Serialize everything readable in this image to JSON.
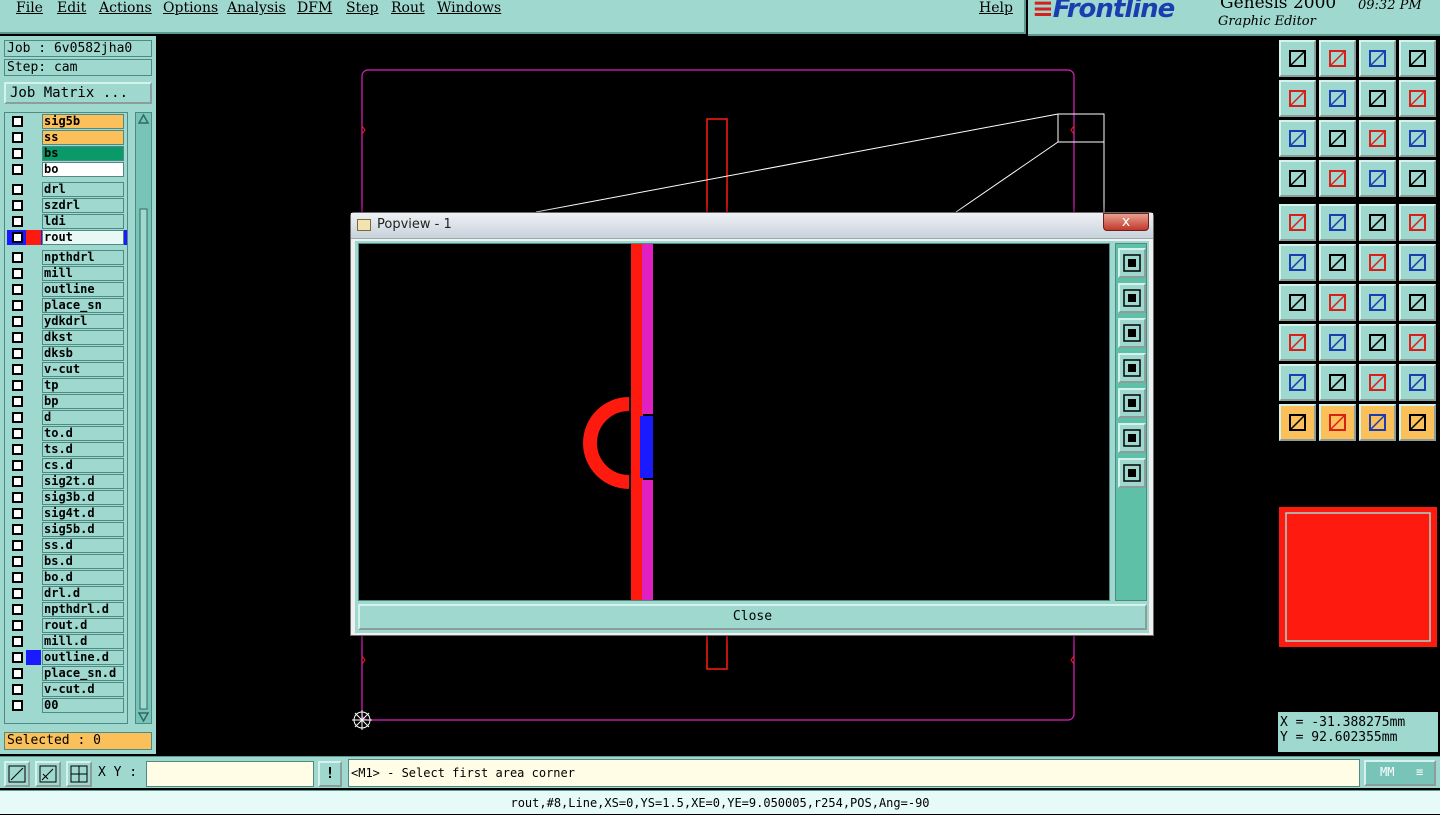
{
  "menu": {
    "items": [
      "File",
      "Edit",
      "Actions",
      "Options",
      "Analysis",
      "DFM",
      "Step",
      "Rout",
      "Windows"
    ],
    "help": "Help"
  },
  "brand": {
    "logo": "Frontline",
    "title": "Genesis 2000",
    "subtitle": "Graphic Editor",
    "clock": "09:32 PM"
  },
  "left": {
    "job": "Job : 6v0582jha0",
    "step": "Step: cam",
    "job_matrix": "Job Matrix ...",
    "selected": "Selected : 0",
    "layers": [
      {
        "name": "sig5b",
        "bg": "#fbc05a",
        "swatch": ""
      },
      {
        "name": "ss",
        "bg": "#fbc05a",
        "swatch": ""
      },
      {
        "name": "bs",
        "bg": "#0a9a6a",
        "swatch": ""
      },
      {
        "name": "bo",
        "bg": "#ffffff",
        "swatch": ""
      },
      {
        "name": "drl",
        "bg": "#9fd8cf",
        "swatch": "",
        "gap": true
      },
      {
        "name": "szdrl",
        "bg": "#9fd8cf",
        "swatch": ""
      },
      {
        "name": "ldi",
        "bg": "#9fd8cf",
        "swatch": ""
      },
      {
        "name": "rout",
        "bg": "#e8f8f5",
        "swatch": "#ff1a10",
        "active": true
      },
      {
        "name": "npthdrl",
        "bg": "#9fd8cf",
        "swatch": "",
        "gap": true
      },
      {
        "name": "mill",
        "bg": "#9fd8cf",
        "swatch": ""
      },
      {
        "name": "outline",
        "bg": "#9fd8cf",
        "swatch": ""
      },
      {
        "name": "place_sn",
        "bg": "#9fd8cf",
        "swatch": ""
      },
      {
        "name": "ydkdrl",
        "bg": "#9fd8cf",
        "swatch": ""
      },
      {
        "name": "dkst",
        "bg": "#9fd8cf",
        "swatch": ""
      },
      {
        "name": "dksb",
        "bg": "#9fd8cf",
        "swatch": ""
      },
      {
        "name": "v-cut",
        "bg": "#9fd8cf",
        "swatch": ""
      },
      {
        "name": "tp",
        "bg": "#9fd8cf",
        "swatch": ""
      },
      {
        "name": "bp",
        "bg": "#9fd8cf",
        "swatch": ""
      },
      {
        "name": "d",
        "bg": "#9fd8cf",
        "swatch": ""
      },
      {
        "name": "to.d",
        "bg": "#9fd8cf",
        "swatch": ""
      },
      {
        "name": "ts.d",
        "bg": "#9fd8cf",
        "swatch": ""
      },
      {
        "name": "cs.d",
        "bg": "#9fd8cf",
        "swatch": ""
      },
      {
        "name": "sig2t.d",
        "bg": "#9fd8cf",
        "swatch": ""
      },
      {
        "name": "sig3b.d",
        "bg": "#9fd8cf",
        "swatch": ""
      },
      {
        "name": "sig4t.d",
        "bg": "#9fd8cf",
        "swatch": ""
      },
      {
        "name": "sig5b.d",
        "bg": "#9fd8cf",
        "swatch": ""
      },
      {
        "name": "ss.d",
        "bg": "#9fd8cf",
        "swatch": ""
      },
      {
        "name": "bs.d",
        "bg": "#9fd8cf",
        "swatch": ""
      },
      {
        "name": "bo.d",
        "bg": "#9fd8cf",
        "swatch": ""
      },
      {
        "name": "drl.d",
        "bg": "#9fd8cf",
        "swatch": ""
      },
      {
        "name": "npthdrl.d",
        "bg": "#9fd8cf",
        "swatch": ""
      },
      {
        "name": "rout.d",
        "bg": "#9fd8cf",
        "swatch": ""
      },
      {
        "name": "mill.d",
        "bg": "#9fd8cf",
        "swatch": ""
      },
      {
        "name": "outline.d",
        "bg": "#9fd8cf",
        "swatch": "#1a1aff"
      },
      {
        "name": "place_sn.d",
        "bg": "#9fd8cf",
        "swatch": ""
      },
      {
        "name": "v-cut.d",
        "bg": "#9fd8cf",
        "swatch": ""
      },
      {
        "name": "00",
        "bg": "#9fd8cf",
        "swatch": ""
      }
    ]
  },
  "popview": {
    "title": "Popview - 1",
    "close_x": "x",
    "close_label": "Close"
  },
  "bottom": {
    "xy_label": "X Y :",
    "xy_value": "",
    "exclaim": "!",
    "prompt": "<M1> - Select first area corner",
    "units": "MM"
  },
  "status": "rout,#8,Line,XS=0,YS=1.5,XE=0,YE=9.050005,r254,POS,Ang=-90",
  "coords": {
    "x": "X = -31.388275mm",
    "y": "Y = 92.602355mm"
  },
  "colors": {
    "panel": "#9fd8cf",
    "rout": "#ff1a10",
    "profile": "#e020c0",
    "highlight": "#1a1aff"
  }
}
